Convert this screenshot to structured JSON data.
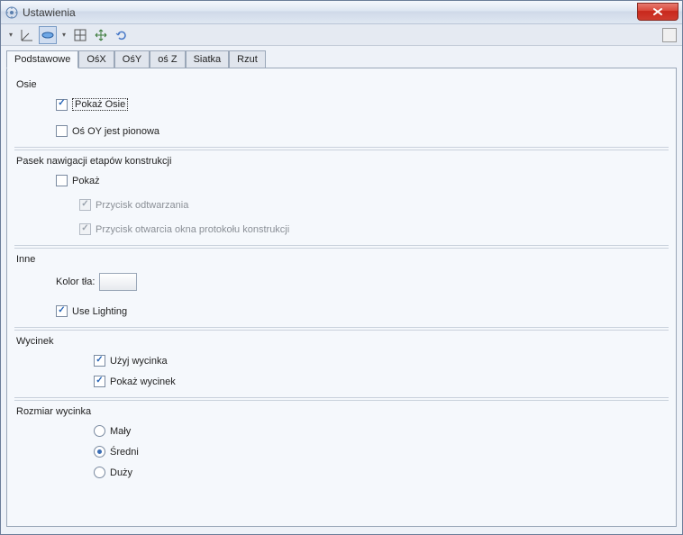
{
  "window": {
    "title": "Ustawienia"
  },
  "tabs": [
    {
      "label": "Podstawowe"
    },
    {
      "label": "OśX"
    },
    {
      "label": "OśY"
    },
    {
      "label": "oś Z"
    },
    {
      "label": "Siatka"
    },
    {
      "label": "Rzut"
    }
  ],
  "groups": {
    "axes": {
      "title": "Osie",
      "show_axes": "Pokaż Osie",
      "oy_vertical": "Oś OY jest pionowa"
    },
    "navbar": {
      "title": "Pasek nawigacji etapów konstrukcji",
      "show": "Pokaż",
      "play_button": "Przycisk odtwarzania",
      "protocol_button": "Przycisk otwarcia okna protokołu konstrukcji"
    },
    "other": {
      "title": "Inne",
      "bgcolor": "Kolor tła:",
      "lighting": "Use Lighting"
    },
    "clipping": {
      "title": "Wycinek",
      "use": "Użyj wycinka",
      "show": "Pokaż wycinek"
    },
    "clipsize": {
      "title": "Rozmiar wycinka",
      "small": "Mały",
      "medium": "Średni",
      "large": "Duży"
    }
  },
  "state": {
    "active_tab": 0,
    "show_axes": true,
    "oy_vertical": false,
    "nav_show": false,
    "nav_play": true,
    "nav_protocol": true,
    "lighting": true,
    "clip_use": true,
    "clip_show": true,
    "clip_size": "medium",
    "bgcolor": "#ffffff"
  }
}
